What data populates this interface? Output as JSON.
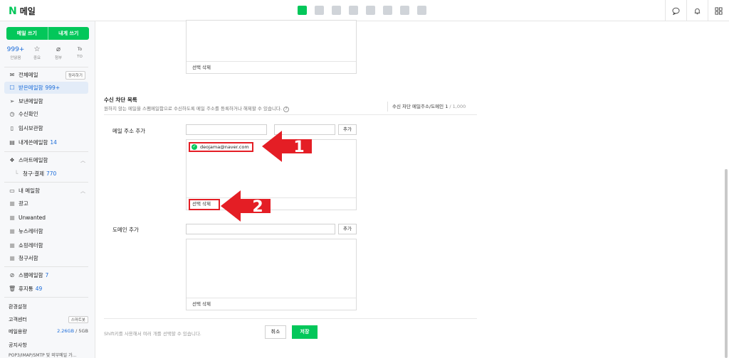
{
  "topbar": {
    "logo_mark": "N",
    "logo_text": "메일",
    "apps": [
      "mail-app-icon",
      "calendar-app-icon",
      "memo-app-icon",
      "contacts-app-icon",
      "drive-app-icon",
      "todo-app-icon",
      "home-app-icon",
      "bookmark-app-icon"
    ],
    "right_icons": [
      "chat-icon",
      "bell-icon",
      "grid-icon"
    ]
  },
  "sidebar": {
    "write_mail": "메일 쓰기",
    "write_self": "내게 쓰기",
    "quick": [
      {
        "value": "999+",
        "label": "안읽음",
        "icon": ""
      },
      {
        "value": "",
        "label": "중요",
        "icon": "☆"
      },
      {
        "value": "",
        "label": "첨부",
        "icon": "⌀"
      },
      {
        "value": "",
        "label": "TO",
        "icon": "To"
      }
    ],
    "items": [
      {
        "label": "전체메일",
        "count": "",
        "badge": "정리하기",
        "icon": "✉"
      },
      {
        "label": "받은메일함",
        "count": "999+",
        "badge": "",
        "icon": "☐"
      },
      {
        "label": "보낸메일함",
        "count": "",
        "badge": "",
        "icon": "➢"
      },
      {
        "label": "수신확인",
        "count": "",
        "badge": "",
        "icon": "◷"
      },
      {
        "label": "임시보관함",
        "count": "",
        "badge": "",
        "icon": "▯"
      },
      {
        "label": "내게쓴메일함",
        "count": "14",
        "badge": "",
        "icon": "▤"
      }
    ],
    "smart": {
      "label": "스마트메일함",
      "icon": "❖"
    },
    "smart_sub": {
      "label": "청구·결제",
      "count": "770"
    },
    "my": {
      "label": "내 메일함",
      "icon": "▭"
    },
    "folders": [
      "광고",
      "Unwanted",
      "뉴스레터함",
      "쇼핑레터함",
      "청구서함"
    ],
    "spam": {
      "label": "스팸메일함",
      "count": "7",
      "icon": "⊘"
    },
    "trash": {
      "label": "휴지통",
      "count": "49",
      "icon": "🗑"
    },
    "settings": "환경설정",
    "support": {
      "label": "고객센터",
      "badge": "스마트봇"
    },
    "storage": {
      "label": "메일용량",
      "used": "2.26GB",
      "total": " / 5GB"
    },
    "notice": "공지사항",
    "pop": "POP3/IMAP/SMTP 및 외부메일 가..."
  },
  "main": {
    "top_delete": "선택 삭제",
    "block_title": "수신 차단 목록",
    "block_desc": "원하지 않는 메일을 스팸메일함으로 수신하도록 메일 주소를 등록하거나 해제할 수 있습니다.",
    "help_icon": "?",
    "count_label": "수신 차단 메일주소/도메인",
    "count_value": "1",
    "count_total": " / 1,000",
    "email_add_label": "메일 주소 추가",
    "add_button": "추가",
    "blocked_email": "deojama@naver.com",
    "email_delete": "선택 삭제",
    "domain_add_label": "도메인 추가",
    "domain_delete": "선택 삭제",
    "hint": "Shift키를 사용해서 여러 개를 선택할 수 있습니다.",
    "cancel": "취소",
    "save": "저장"
  },
  "annotations": [
    {
      "number": "1",
      "color": "#e41e25"
    },
    {
      "number": "2",
      "color": "#e41e25"
    }
  ]
}
